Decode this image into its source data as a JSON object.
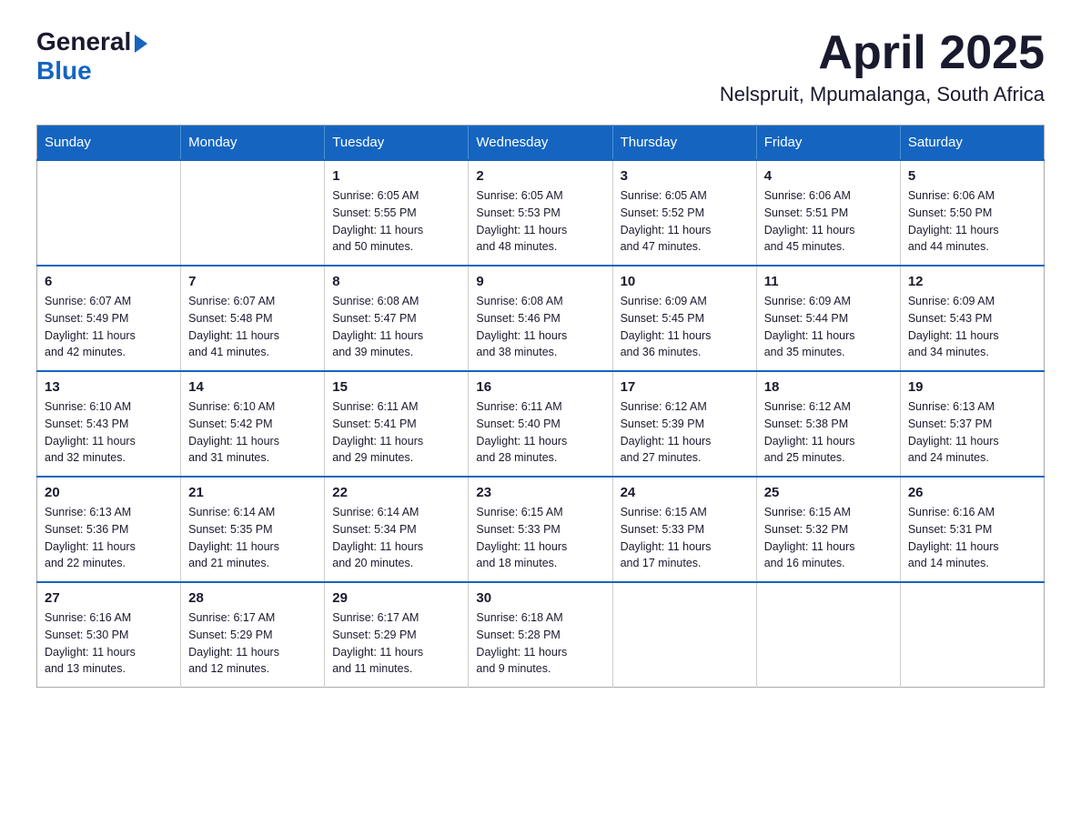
{
  "logo": {
    "general": "General",
    "blue": "Blue"
  },
  "title": "April 2025",
  "subtitle": "Nelspruit, Mpumalanga, South Africa",
  "weekdays": [
    "Sunday",
    "Monday",
    "Tuesday",
    "Wednesday",
    "Thursday",
    "Friday",
    "Saturday"
  ],
  "weeks": [
    [
      {
        "day": "",
        "info": ""
      },
      {
        "day": "",
        "info": ""
      },
      {
        "day": "1",
        "info": "Sunrise: 6:05 AM\nSunset: 5:55 PM\nDaylight: 11 hours\nand 50 minutes."
      },
      {
        "day": "2",
        "info": "Sunrise: 6:05 AM\nSunset: 5:53 PM\nDaylight: 11 hours\nand 48 minutes."
      },
      {
        "day": "3",
        "info": "Sunrise: 6:05 AM\nSunset: 5:52 PM\nDaylight: 11 hours\nand 47 minutes."
      },
      {
        "day": "4",
        "info": "Sunrise: 6:06 AM\nSunset: 5:51 PM\nDaylight: 11 hours\nand 45 minutes."
      },
      {
        "day": "5",
        "info": "Sunrise: 6:06 AM\nSunset: 5:50 PM\nDaylight: 11 hours\nand 44 minutes."
      }
    ],
    [
      {
        "day": "6",
        "info": "Sunrise: 6:07 AM\nSunset: 5:49 PM\nDaylight: 11 hours\nand 42 minutes."
      },
      {
        "day": "7",
        "info": "Sunrise: 6:07 AM\nSunset: 5:48 PM\nDaylight: 11 hours\nand 41 minutes."
      },
      {
        "day": "8",
        "info": "Sunrise: 6:08 AM\nSunset: 5:47 PM\nDaylight: 11 hours\nand 39 minutes."
      },
      {
        "day": "9",
        "info": "Sunrise: 6:08 AM\nSunset: 5:46 PM\nDaylight: 11 hours\nand 38 minutes."
      },
      {
        "day": "10",
        "info": "Sunrise: 6:09 AM\nSunset: 5:45 PM\nDaylight: 11 hours\nand 36 minutes."
      },
      {
        "day": "11",
        "info": "Sunrise: 6:09 AM\nSunset: 5:44 PM\nDaylight: 11 hours\nand 35 minutes."
      },
      {
        "day": "12",
        "info": "Sunrise: 6:09 AM\nSunset: 5:43 PM\nDaylight: 11 hours\nand 34 minutes."
      }
    ],
    [
      {
        "day": "13",
        "info": "Sunrise: 6:10 AM\nSunset: 5:43 PM\nDaylight: 11 hours\nand 32 minutes."
      },
      {
        "day": "14",
        "info": "Sunrise: 6:10 AM\nSunset: 5:42 PM\nDaylight: 11 hours\nand 31 minutes."
      },
      {
        "day": "15",
        "info": "Sunrise: 6:11 AM\nSunset: 5:41 PM\nDaylight: 11 hours\nand 29 minutes."
      },
      {
        "day": "16",
        "info": "Sunrise: 6:11 AM\nSunset: 5:40 PM\nDaylight: 11 hours\nand 28 minutes."
      },
      {
        "day": "17",
        "info": "Sunrise: 6:12 AM\nSunset: 5:39 PM\nDaylight: 11 hours\nand 27 minutes."
      },
      {
        "day": "18",
        "info": "Sunrise: 6:12 AM\nSunset: 5:38 PM\nDaylight: 11 hours\nand 25 minutes."
      },
      {
        "day": "19",
        "info": "Sunrise: 6:13 AM\nSunset: 5:37 PM\nDaylight: 11 hours\nand 24 minutes."
      }
    ],
    [
      {
        "day": "20",
        "info": "Sunrise: 6:13 AM\nSunset: 5:36 PM\nDaylight: 11 hours\nand 22 minutes."
      },
      {
        "day": "21",
        "info": "Sunrise: 6:14 AM\nSunset: 5:35 PM\nDaylight: 11 hours\nand 21 minutes."
      },
      {
        "day": "22",
        "info": "Sunrise: 6:14 AM\nSunset: 5:34 PM\nDaylight: 11 hours\nand 20 minutes."
      },
      {
        "day": "23",
        "info": "Sunrise: 6:15 AM\nSunset: 5:33 PM\nDaylight: 11 hours\nand 18 minutes."
      },
      {
        "day": "24",
        "info": "Sunrise: 6:15 AM\nSunset: 5:33 PM\nDaylight: 11 hours\nand 17 minutes."
      },
      {
        "day": "25",
        "info": "Sunrise: 6:15 AM\nSunset: 5:32 PM\nDaylight: 11 hours\nand 16 minutes."
      },
      {
        "day": "26",
        "info": "Sunrise: 6:16 AM\nSunset: 5:31 PM\nDaylight: 11 hours\nand 14 minutes."
      }
    ],
    [
      {
        "day": "27",
        "info": "Sunrise: 6:16 AM\nSunset: 5:30 PM\nDaylight: 11 hours\nand 13 minutes."
      },
      {
        "day": "28",
        "info": "Sunrise: 6:17 AM\nSunset: 5:29 PM\nDaylight: 11 hours\nand 12 minutes."
      },
      {
        "day": "29",
        "info": "Sunrise: 6:17 AM\nSunset: 5:29 PM\nDaylight: 11 hours\nand 11 minutes."
      },
      {
        "day": "30",
        "info": "Sunrise: 6:18 AM\nSunset: 5:28 PM\nDaylight: 11 hours\nand 9 minutes."
      },
      {
        "day": "",
        "info": ""
      },
      {
        "day": "",
        "info": ""
      },
      {
        "day": "",
        "info": ""
      }
    ]
  ]
}
